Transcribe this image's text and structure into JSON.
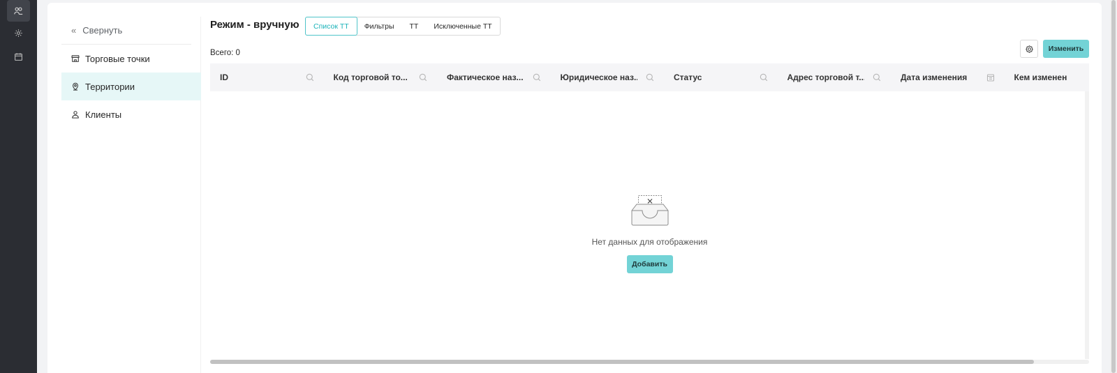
{
  "rail": {
    "items": [
      {
        "icon": "users-icon",
        "active": true
      },
      {
        "icon": "gear-icon",
        "active": false
      },
      {
        "icon": "calendar-icon",
        "active": false
      }
    ]
  },
  "subnav": {
    "collapse_label": "Свернуть",
    "items": [
      {
        "label": "Торговые точки",
        "icon": "store-icon"
      },
      {
        "label": "Территории",
        "icon": "map-pin-icon",
        "active": true
      },
      {
        "label": "Клиенты",
        "icon": "user-icon"
      }
    ]
  },
  "header": {
    "title": "Режим - вручную",
    "tabs": [
      {
        "label": "Список ТТ",
        "active": true
      },
      {
        "label": "Фильтры"
      },
      {
        "label": "ТТ"
      },
      {
        "label": "Исключенные ТТ"
      }
    ]
  },
  "toolbar": {
    "total_label": "Всего: 0",
    "edit_label": "Изменить"
  },
  "table": {
    "columns": [
      {
        "label": "ID",
        "filter": "search-icon"
      },
      {
        "label": "Код торговой то...",
        "filter": "search-icon"
      },
      {
        "label": "Фактическое наз...",
        "filter": "search-icon"
      },
      {
        "label": "Юридическое наз...",
        "filter": "search-icon"
      },
      {
        "label": "Статус",
        "filter": "search-icon"
      },
      {
        "label": "Адрес торговой т...",
        "filter": "search-icon"
      },
      {
        "label": "Дата изменения",
        "filter": "calendar-icon"
      },
      {
        "label": "Кем изменен",
        "filter": ""
      }
    ],
    "rows": []
  },
  "empty": {
    "text": "Нет данных для отображения",
    "add_label": "Добавить"
  },
  "colors": {
    "accent": "#73d3d6",
    "accent_text": "#1bb3b9",
    "rail": "#2b2d33",
    "active_bg": "#e6f7f7"
  }
}
